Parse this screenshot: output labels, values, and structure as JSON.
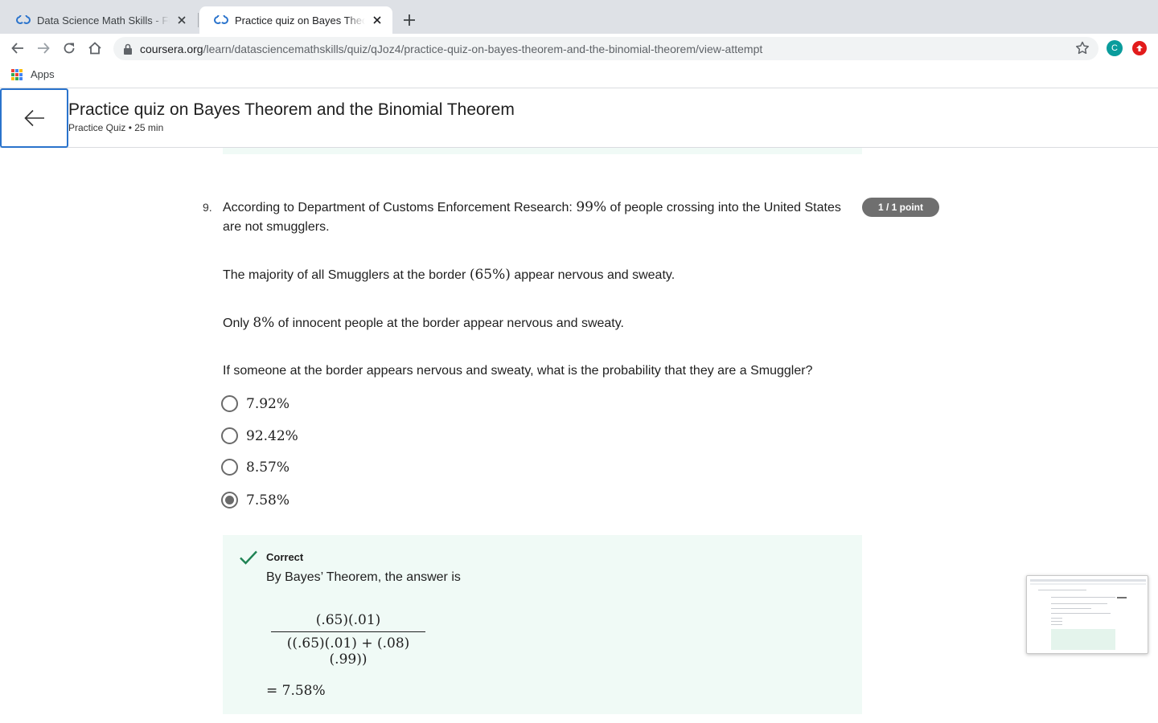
{
  "browser": {
    "tabs": [
      {
        "title": "Data Science Math Skills - Fun",
        "active": false
      },
      {
        "title": "Practice quiz on Bayes Theorem",
        "active": true
      }
    ],
    "url": {
      "host": "coursera.org",
      "path": "/learn/datasciencemathskills/quiz/qJoz4/practice-quiz-on-bayes-theorem-and-the-binomial-theorem/view-attempt"
    },
    "profile_initial": "C",
    "bookmarks": {
      "apps_label": "Apps"
    }
  },
  "header": {
    "title": "Practice quiz on Bayes Theorem and the Binomial Theorem",
    "meta": "Practice Quiz • 25 min"
  },
  "question": {
    "number": "9.",
    "points": "1 / 1 point",
    "p1": {
      "a": "According to Department of Customs Enforcement Research: ",
      "m": "99%",
      "b": " of people crossing into the United States are not smugglers."
    },
    "p2": {
      "a": "The majority of all Smugglers at the border ",
      "m": "(65%)",
      "b": " appear nervous and sweaty."
    },
    "p3": {
      "a": "Only ",
      "m": "8%",
      "b": " of innocent people at the border appear nervous and sweaty."
    },
    "p4": "If someone at the border appears nervous and sweaty, what is the probability that they are a Smuggler?",
    "options": [
      {
        "label": "7.92%",
        "selected": false
      },
      {
        "label": "92.42%",
        "selected": false
      },
      {
        "label": "8.57%",
        "selected": false
      },
      {
        "label": "7.58%",
        "selected": true
      }
    ]
  },
  "feedback": {
    "status": "Correct",
    "text": "By Bayes’ Theorem, the answer is",
    "numerator": "(.65)(.01)",
    "denominator": "((.65)(.01) + (.08)(.99))",
    "result": "= 7.58%"
  },
  "colors": {
    "accent_blue": "#2a73cc",
    "correct_green": "#1f8354",
    "feedback_bg": "#f0faf6",
    "badge_gray": "#6f6f6f"
  }
}
